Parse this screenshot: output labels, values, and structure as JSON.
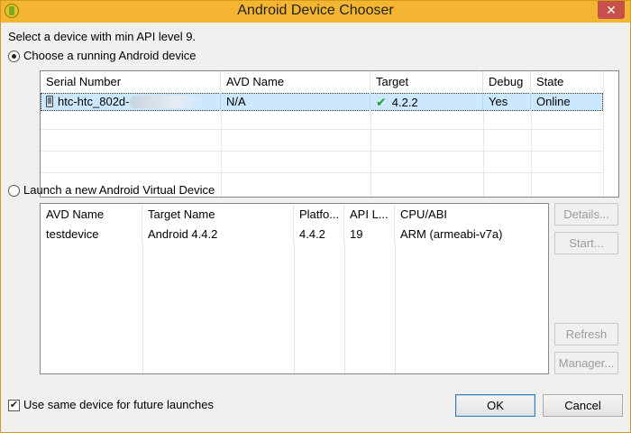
{
  "window": {
    "title": "Android Device Chooser",
    "close_label": "✕"
  },
  "prompt": "Select a device with min API level 9.",
  "running": {
    "radio_label": "Choose a running Android device",
    "columns": [
      "Serial Number",
      "AVD Name",
      "Target",
      "Debug",
      "State"
    ],
    "rows": [
      {
        "serial": "htc-htc_802d-",
        "avd": "N/A",
        "target": "4.2.2",
        "debug": "Yes",
        "state": "Online"
      }
    ]
  },
  "avd": {
    "radio_label": "Launch a new Android Virtual Device",
    "columns": [
      "AVD Name",
      "Target Name",
      "Platfo...",
      "API L...",
      "CPU/ABI"
    ],
    "rows": [
      {
        "name": "testdevice",
        "target": "Android 4.4.2",
        "platform": "4.4.2",
        "api": "19",
        "abi": "ARM (armeabi-v7a)"
      }
    ],
    "buttons": {
      "details": "Details...",
      "start": "Start...",
      "refresh": "Refresh",
      "manager": "Manager..."
    }
  },
  "footer": {
    "same_device_label": "Use same device for future launches",
    "same_device_checked": true,
    "ok": "OK",
    "cancel": "Cancel"
  },
  "icons": {
    "app": "android-icon",
    "device": "phone-icon",
    "target_ok": "checkmark-icon"
  },
  "colors": {
    "titlebar": "#f4b632",
    "selection": "#cce8ff",
    "check": "#2aa030"
  }
}
